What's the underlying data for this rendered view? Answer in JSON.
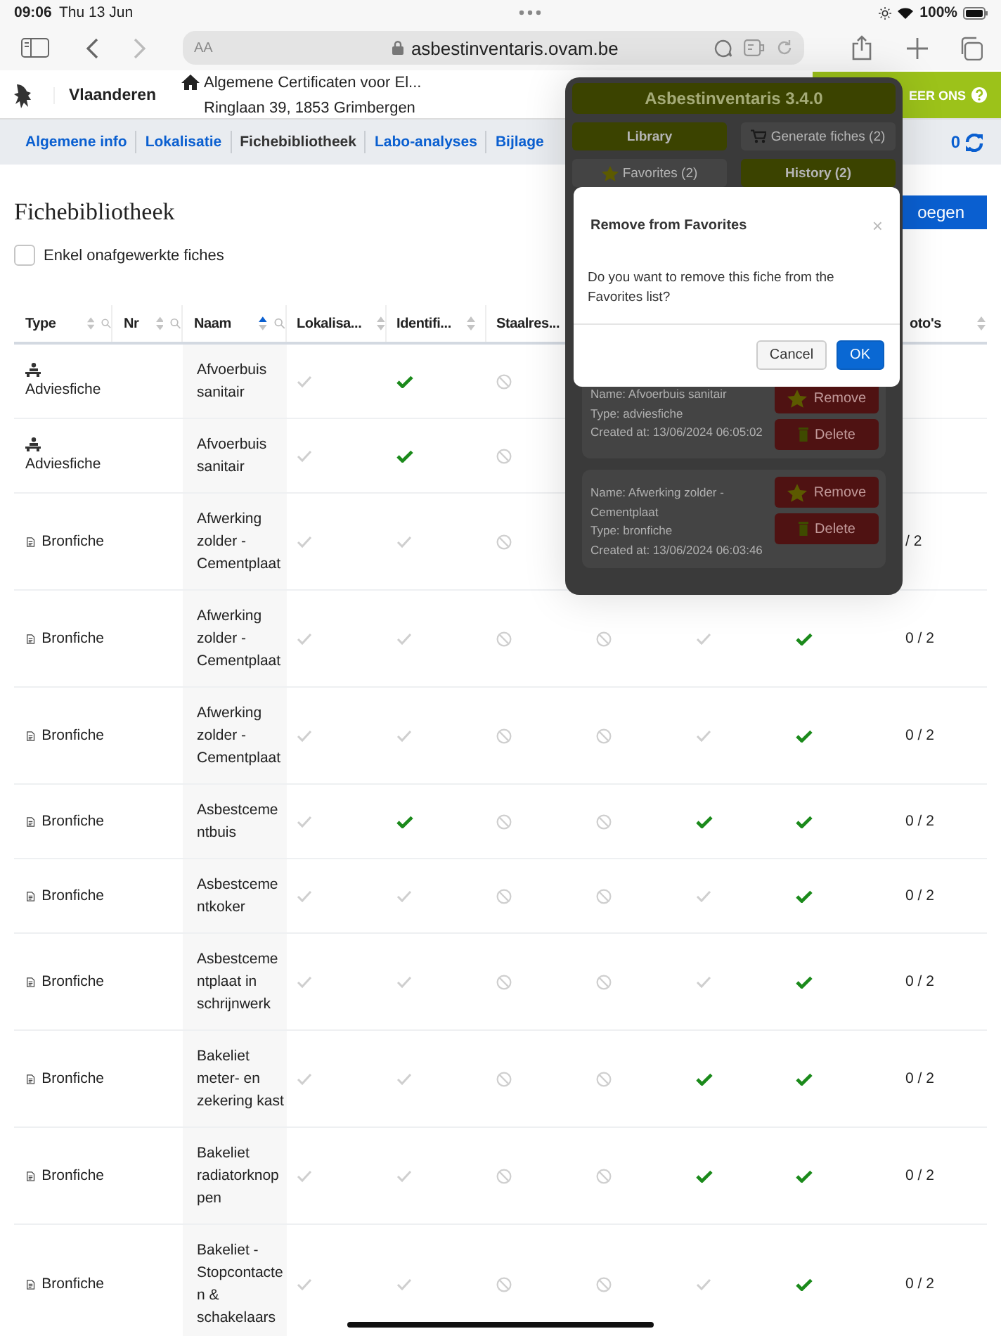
{
  "status_bar": {
    "time": "09:06",
    "date": "Thu 13 Jun",
    "battery": "100%"
  },
  "browser": {
    "text_size": "AA",
    "url": "asbestinventaris.ovam.be"
  },
  "site_header": {
    "brand": "Vlaanderen",
    "breadcrumb": [
      "Algemene Certificaten voor El...",
      "Ringlaan 39, 1853 Grimbergen"
    ],
    "contact": "EER ONS"
  },
  "nav": {
    "tabs": [
      {
        "label": "Algemene info",
        "selected": false
      },
      {
        "label": "Lokalisatie",
        "selected": false
      },
      {
        "label": "Fichebibliotheek",
        "selected": true
      },
      {
        "label": "Labo-analyses",
        "selected": false
      },
      {
        "label": "Bijlage",
        "selected": false
      }
    ],
    "counter": "0"
  },
  "page": {
    "title": "Fichebibliotheek",
    "add_button": "oegen",
    "filter": {
      "label": "Enkel onafgewerkte fiches",
      "checked": false
    }
  },
  "table": {
    "columns": [
      {
        "label": "Type",
        "sorted": false,
        "search": true
      },
      {
        "label": "Nr",
        "sorted": false,
        "search": true
      },
      {
        "label": "Naam",
        "sorted": true,
        "search": true
      },
      {
        "label": "Lokalisa...",
        "sorted": false,
        "search": false
      },
      {
        "label": "Identifi...",
        "sorted": false,
        "search": false
      },
      {
        "label": "Staalres...",
        "search": false
      }
    ],
    "photo_column": {
      "label": "oto's",
      "sorted": false
    },
    "rows": [
      {
        "type": {
          "kind": "adviesfiche",
          "label": "Adviesfiche"
        },
        "naam": "Afvoerbuis sanitair",
        "statuses": [
          {
            "kind": "todo"
          },
          {
            "kind": "done"
          },
          {
            "kind": "na"
          }
        ]
      },
      {
        "type": {
          "kind": "adviesfiche",
          "label": "Adviesfiche"
        },
        "naam": "Afvoerbuis sanitair",
        "statuses": [
          {
            "kind": "todo"
          },
          {
            "kind": "done"
          },
          {
            "kind": "na"
          }
        ]
      },
      {
        "type": {
          "kind": "bronfiche",
          "label": "Bronfiche"
        },
        "naam": "Afwerking zolder - Cementplaat",
        "statuses": [
          {
            "kind": "todo"
          },
          {
            "kind": "todo"
          },
          {
            "kind": "na"
          }
        ],
        "fotos": "/ 2"
      },
      {
        "type": {
          "kind": "bronfiche",
          "label": "Bronfiche"
        },
        "naam": "Afwerking zolder - Cementplaat",
        "statuses": [
          {
            "kind": "todo"
          },
          {
            "kind": "todo"
          },
          {
            "kind": "na"
          },
          {
            "kind": "na"
          },
          {
            "kind": "todo"
          },
          {
            "kind": "done"
          }
        ],
        "fotos": "0 / 2"
      },
      {
        "type": {
          "kind": "bronfiche",
          "label": "Bronfiche"
        },
        "naam": "Afwerking zolder - Cementplaat",
        "statuses": [
          {
            "kind": "todo"
          },
          {
            "kind": "todo"
          },
          {
            "kind": "na"
          },
          {
            "kind": "na"
          },
          {
            "kind": "todo"
          },
          {
            "kind": "done"
          }
        ],
        "fotos": "0 / 2"
      },
      {
        "type": {
          "kind": "bronfiche",
          "label": "Bronfiche"
        },
        "naam": "Asbestcementbuis",
        "statuses": [
          {
            "kind": "todo"
          },
          {
            "kind": "done"
          },
          {
            "kind": "na"
          },
          {
            "kind": "na"
          },
          {
            "kind": "done"
          },
          {
            "kind": "done"
          }
        ],
        "fotos": "0 / 2"
      },
      {
        "type": {
          "kind": "bronfiche",
          "label": "Bronfiche"
        },
        "naam": "Asbestcementkoker",
        "statuses": [
          {
            "kind": "todo"
          },
          {
            "kind": "todo"
          },
          {
            "kind": "na"
          },
          {
            "kind": "na"
          },
          {
            "kind": "todo"
          },
          {
            "kind": "done"
          }
        ],
        "fotos": "0 / 2"
      },
      {
        "type": {
          "kind": "bronfiche",
          "label": "Bronfiche"
        },
        "naam": "Asbestcementplaat in schrijnwerk",
        "statuses": [
          {
            "kind": "todo"
          },
          {
            "kind": "todo"
          },
          {
            "kind": "na"
          },
          {
            "kind": "na"
          },
          {
            "kind": "todo"
          },
          {
            "kind": "done"
          }
        ],
        "fotos": "0 / 2"
      },
      {
        "type": {
          "kind": "bronfiche",
          "label": "Bronfiche"
        },
        "naam": "Bakeliet meter- en zekering kast",
        "statuses": [
          {
            "kind": "todo"
          },
          {
            "kind": "todo"
          },
          {
            "kind": "na"
          },
          {
            "kind": "na"
          },
          {
            "kind": "done"
          },
          {
            "kind": "done"
          }
        ],
        "fotos": "0 / 2"
      },
      {
        "type": {
          "kind": "bronfiche",
          "label": "Bronfiche"
        },
        "naam": "Bakeliet radiatorknoppen",
        "statuses": [
          {
            "kind": "todo"
          },
          {
            "kind": "todo"
          },
          {
            "kind": "na"
          },
          {
            "kind": "na"
          },
          {
            "kind": "done"
          },
          {
            "kind": "done"
          }
        ],
        "fotos": "0 / 2"
      },
      {
        "type": {
          "kind": "bronfiche",
          "label": "Bronfiche"
        },
        "naam": "Bakeliet - Stopcontacten & schakelaars",
        "statuses": [
          {
            "kind": "todo"
          },
          {
            "kind": "todo"
          },
          {
            "kind": "na"
          },
          {
            "kind": "na"
          },
          {
            "kind": "todo"
          },
          {
            "kind": "done"
          }
        ],
        "fotos": "0 / 2"
      }
    ]
  },
  "extension_popup": {
    "title": "Asbestinventaris 3.4.0",
    "tab_rows": [
      [
        {
          "kind": "library",
          "label": "Library",
          "selected": true
        },
        {
          "kind": "generate",
          "label": "Generate fiches (2)",
          "selected": false
        }
      ],
      [
        {
          "kind": "favorites",
          "label": "Favorites (2)",
          "selected": false
        },
        {
          "kind": "history",
          "label": "History (2)",
          "selected": true
        }
      ]
    ],
    "cards": [
      {
        "lines": [
          "Name: Afvoerbuis sanitair",
          "Type: adviesfiche",
          "Created at: 13/06/2024 06:05:02"
        ],
        "buttons": [
          {
            "kind": "remove",
            "label": "Remove"
          },
          {
            "kind": "delete",
            "label": "Delete"
          }
        ]
      },
      {
        "lines": [
          "Name: Afwerking zolder - Cementplaat",
          "Type: bronfiche",
          "Created at: 13/06/2024 06:03:46"
        ],
        "buttons": [
          {
            "kind": "remove",
            "label": "Remove"
          },
          {
            "kind": "delete",
            "label": "Delete"
          }
        ]
      }
    ],
    "modal": {
      "title": "Remove from Favorites",
      "close": "×",
      "message": "Do you want to remove this fiche from the Favorites list?",
      "buttons": [
        {
          "kind": "secondary",
          "label": "Cancel"
        },
        {
          "kind": "primary",
          "label": "OK"
        }
      ]
    }
  }
}
